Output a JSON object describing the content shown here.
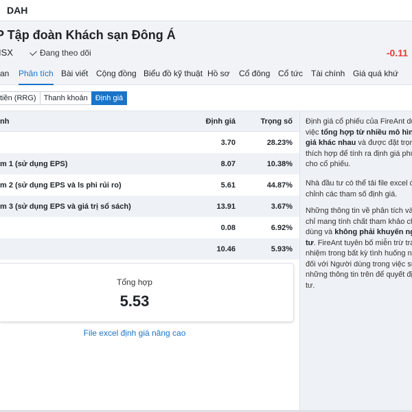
{
  "app": {
    "ticker": "DAH"
  },
  "header": {
    "company_name": "P Tập đoàn Khách sạn Đông Á",
    "exchange": "ISX",
    "follow_label": "Đang theo dõi",
    "change": "-0.11"
  },
  "tabs": [
    {
      "label": "an",
      "active": false
    },
    {
      "label": "Phân tích",
      "active": true
    },
    {
      "label": "Bài viết",
      "active": false
    },
    {
      "label": "Cộng đồng",
      "active": false
    },
    {
      "label": "Biểu đồ kỹ thuật",
      "active": false
    },
    {
      "label": "Hồ sơ",
      "active": false
    },
    {
      "label": "Cổ đông",
      "active": false
    },
    {
      "label": "Cổ tức",
      "active": false
    },
    {
      "label": "Tài chính",
      "active": false
    },
    {
      "label": "Giá quá khứ",
      "active": false
    }
  ],
  "subtabs": [
    {
      "label": "tiền (RRG)",
      "active": false
    },
    {
      "label": "Thanh khoản",
      "active": false
    },
    {
      "label": "Định giá",
      "active": true
    }
  ],
  "table": {
    "headers": {
      "name": "nh",
      "value": "Định giá",
      "weight": "Trọng số"
    },
    "rows": [
      {
        "name": "",
        "value": "3.70",
        "weight": "28.23%"
      },
      {
        "name": "m 1 (sử dụng EPS)",
        "value": "8.07",
        "weight": "10.38%"
      },
      {
        "name": "m 2 (sử dụng EPS và ls phi rủi ro)",
        "value": "5.61",
        "weight": "44.87%"
      },
      {
        "name": "m 3 (sử dụng EPS và giá trị sổ sách)",
        "value": "13.91",
        "weight": "3.67%"
      },
      {
        "name": "",
        "value": "0.08",
        "weight": "6.92%"
      },
      {
        "name": "",
        "value": "10.46",
        "weight": "5.93%"
      }
    ]
  },
  "summary": {
    "label": "Tổng hợp",
    "value": "5.53"
  },
  "excel_link": "File excel định giá nâng cao",
  "side": {
    "p1_a": "Định giá cổ phiếu của FireAnt dự",
    "p1_b": "việc ",
    "p1_c": "tổng hợp từ nhiều mô hìn",
    "p1_d": "giá khác nhau",
    "p1_e": " và được đặt trọn",
    "p1_f": "thích hợp để tính ra định giá phù",
    "p1_g": "cho cổ phiếu.",
    "p2_a": "Nhà đầu tư có thể tải file excel đ",
    "p2_b": "chỉnh các tham số định giá.",
    "p3_a": "Những thông tin về phân tích và",
    "p3_b": "chỉ mang tính chất tham khảo ch",
    "p3_c": "dùng và ",
    "p3_d": "không phải khuyến ng",
    "p3_e": "tư",
    "p3_f": ". FireAnt tuyên bố miễn trừ trá",
    "p3_g": "nhiệm trong bất kỳ tình huống na",
    "p3_h": "đối với Người dùng trong việc sử",
    "p3_i": "những thông tin trên để quyết địn",
    "p3_j": "tư."
  },
  "colors": {
    "accent": "#1a73c8",
    "negative": "#e53935",
    "panel": "#eef1f5"
  }
}
